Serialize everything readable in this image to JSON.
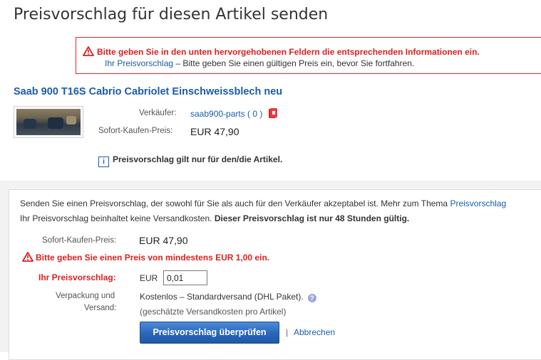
{
  "page": {
    "title": "Preisvorschlag für diesen Artikel senden"
  },
  "error_box": {
    "message": "Bitte geben Sie in den unten hervorgehobenen Feldern die entsprechenden Informationen ein.",
    "field_link": "Ihr Preisvorschlag",
    "field_message": " – Bitte geben Sie einen gültigen Preis ein, bevor Sie fortfahren."
  },
  "item": {
    "title": "Saab 900 T16S Cabrio Cabriolet Einschweissblech neu",
    "seller_label": "Verkäufer:",
    "seller_name": "saab900-parts",
    "seller_feedback_open": " ( ",
    "seller_feedback": "0",
    "seller_feedback_close": " )",
    "buy_now_label": "Sofort-Kaufen-Preis:",
    "buy_now_price": "EUR 47,90",
    "note": "Preisvorschlag gilt nur für den/die Artikel."
  },
  "offer_form": {
    "intro_text": "Senden Sie einen Preisvorschlag, der sowohl für Sie als auch für den Verkäufer akzeptabel ist. Mehr zum Thema ",
    "intro_link": "Preisvorschlag",
    "shipping_note": "Ihr Preisvorschlag beinhaltet keine Versandkosten. ",
    "validity_note": "Dieser Preisvorschlag ist nur 48 Stunden gültig.",
    "buy_now_label": "Sofort-Kaufen-Preis:",
    "buy_now_price": "EUR 47,90",
    "error": "Bitte geben Sie einen Preis von mindestens EUR 1,00 ein.",
    "offer_label": "Ihr Preisvorschlag:",
    "currency": "EUR",
    "offer_value": "0,01",
    "shipping_label_line1": "Verpackung und",
    "shipping_label_line2": "Versand:",
    "shipping_value": "Kostenlos – Standardversand (DHL Paket).",
    "shipping_sub": "(geschätzte Versandkosten pro Artikel)",
    "submit_label": "Preisvorschlag überprüfen",
    "separator": "|",
    "cancel_label": "Abbrechen"
  },
  "colors": {
    "error_red": "#dd1e1e",
    "link_blue": "#1a5dab",
    "button_blue": "#2a66b8",
    "panel_bg": "#f2f2f2"
  },
  "icons": [
    "warning-icon",
    "info-icon",
    "help-icon",
    "seller-badge-icon"
  ]
}
